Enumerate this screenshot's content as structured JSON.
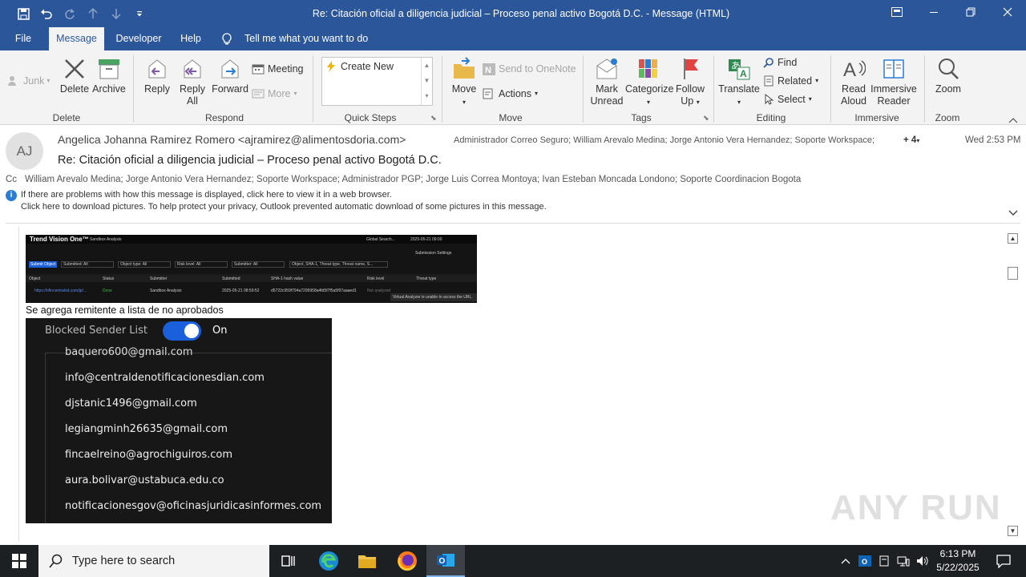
{
  "window": {
    "title": "Re: Citación oficial a diligencia judicial – Proceso penal activo Bogotá D.C.  -  Message (HTML)"
  },
  "tabs": [
    "File",
    "Message",
    "Developer",
    "Help"
  ],
  "tell_me": "Tell me what you want to do",
  "ribbon": {
    "junk": "Junk",
    "delete": "Delete",
    "archive": "Archive",
    "reply": "Reply",
    "reply_all_1": "Reply",
    "reply_all_2": "All",
    "forward": "Forward",
    "meeting": "Meeting",
    "more": "More",
    "quick_steps_item": "Create New",
    "move": "Move",
    "send_to_onenote": "Send to OneNote",
    "actions": "Actions",
    "mark_unread_1": "Mark",
    "mark_unread_2": "Unread",
    "categorize": "Categorize",
    "follow_up_1": "Follow",
    "follow_up_2": "Up",
    "translate": "Translate",
    "find": "Find",
    "related": "Related",
    "select": "Select",
    "read_aloud_1": "Read",
    "read_aloud_2": "Aloud",
    "immersive_1": "Immersive",
    "immersive_2": "Reader",
    "zoom": "Zoom",
    "groups": {
      "delete": "Delete",
      "respond": "Respond",
      "quick_steps": "Quick Steps",
      "move": "Move",
      "tags": "Tags",
      "editing": "Editing",
      "immersive": "Immersive",
      "zoom": "Zoom"
    }
  },
  "message": {
    "avatar_initials": "AJ",
    "from": "Angelica Johanna Ramirez Romero <ajramirez@alimentosdoria.com>",
    "to": "Administrador Correo Seguro; William Arevalo Medina; Jorge Antonio Vera Hernandez; Soporte Workspace;",
    "more_recipients": "+ 4",
    "date": "Wed 2:53 PM",
    "subject": "Re: Citación oficial a diligencia judicial – Proceso penal activo Bogotá D.C.",
    "cc_label": "Cc",
    "cc": "William Arevalo Medina; Jorge Antonio Vera Hernandez; Soporte Workspace; Administrador PGP; Jorge Luis Correa Montoya; Ivan Esteban Moncada Londono; Soporte Coordinacion Bogota",
    "info_1": "If there are problems with how this message is displayed, click here to view it in a web browser.",
    "info_2": "Click here to download pictures. To help protect your privacy, Outlook prevented automatic download of some pictures in this message."
  },
  "body": {
    "tv_logo": "Trend Vision One™",
    "tv_app": "Sandbox Analysis",
    "tv_search": "Global Search...",
    "tv_date": "2025-05-21 09:00",
    "tv_settings": "Submission Settings",
    "tv_submit": "Submit Object",
    "tv_f1": "Submitted: All",
    "tv_f2": "Object type: All",
    "tv_f3": "Risk level: All",
    "tv_f4": "Submitter: All",
    "tv_search2": "Object, SHA-1, Threat type, Threat name, S...",
    "tv_cols": [
      "Object",
      "Status",
      "Submitter",
      "Submitted",
      "SHA-1 hash value",
      "Risk level",
      "Threat type"
    ],
    "tv_row": [
      "https://ofincentralsd.com/jp/...",
      "Done",
      "Sandbox Analysis",
      "2025-05-21 08:59:52",
      "d5722c959f794a7295958a4fd5f7f5a5f97aaaed1",
      "Not analyzed",
      "Virtual Analyzer is unable to access the URL."
    ],
    "note": "Se agrega remitente a lista de no aprobados",
    "bs_title": "Blocked Sender List",
    "bs_toggle": "On",
    "bs_partial": "baquero600@gmail.com",
    "bs_list": [
      "info@centraldenotificacionesdian.com",
      "djstanic1496@gmail.com",
      "legiangminh26635@gmail.com",
      "fincaelreino@agrochiguiros.com",
      "aura.bolivar@ustabuca.edu.co",
      "notificacionesgov@oficinasjuridicasinformes.com"
    ]
  },
  "watermark": "ANY RUN",
  "taskbar": {
    "search_placeholder": "Type here to search",
    "time": "6:13 PM",
    "date": "5/22/2025"
  },
  "colors": {
    "title_bar": "#2b579a",
    "ribbon": "#f3f3f3",
    "taskbar": "#1d2023",
    "toggle_on": "#1a5fdb",
    "blocked_panel": "#171717"
  }
}
